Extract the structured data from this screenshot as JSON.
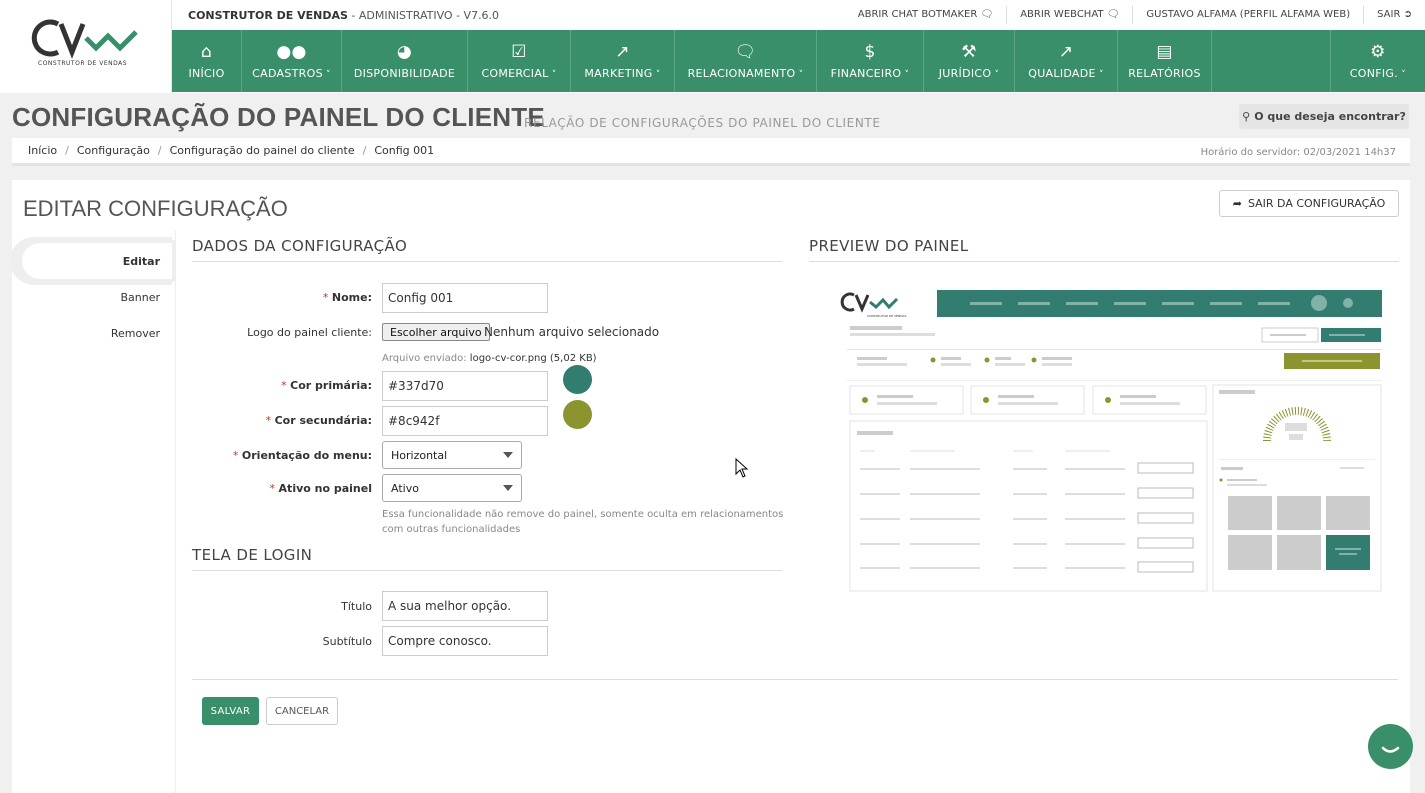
{
  "header": {
    "logo_sub": "CONSTRUTOR DE VENDAS",
    "system_name": "CONSTRUTOR DE VENDAS",
    "system_suffix": " - ADMINISTRATIVO - V7.6.0",
    "links": {
      "chat_botmaker": "ABRIR CHAT BOTMAKER",
      "webchat": "ABRIR WEBCHAT",
      "user": "GUSTAVO ALFAMA (PERFIL ALFAMA WEB)",
      "logout": "SAIR"
    }
  },
  "nav": {
    "inicio": "INÍCIO",
    "cadastros": "CADASTROS",
    "disponibilidade": "DISPONIBILIDADE",
    "comercial": "COMERCIAL",
    "marketing": "MARKETING",
    "relacionamento": "RELACIONAMENTO",
    "financeiro": "FINANCEIRO",
    "juridico": "JURÍDICO",
    "qualidade": "QUALIDADE",
    "relatorios": "RELATÓRIOS",
    "config": "CONFIG."
  },
  "page": {
    "title": "CONFIGURAÇÃO DO PAINEL DO CLIENTE",
    "subtitle": "RELAÇÃO DE CONFIGURAÇÕES DO PAINEL DO CLIENTE",
    "search_label": "O que deseja encontrar?"
  },
  "breadcrumb": {
    "items": [
      "Início",
      "Configuração",
      "Configuração do painel do cliente",
      "Config 001"
    ],
    "server_time": "Horário do servidor: 02/03/2021 14h37"
  },
  "card": {
    "title": "EDITAR CONFIGURAÇÃO",
    "exit_label": "SAIR DA CONFIGURAÇÃO"
  },
  "sidenav": {
    "edit": "Editar",
    "banner": "Banner",
    "remove": "Remover"
  },
  "form": {
    "section_data": "DADOS DA CONFIGURAÇÃO",
    "section_login": "TELA DE LOGIN",
    "section_preview": "PREVIEW DO PAINEL",
    "name_label": "Nome:",
    "name_value": "Config 001",
    "logo_label": "Logo do painel cliente:",
    "file_button": "Escolher arquivo",
    "file_none": "Nenhum arquivo selecionado",
    "file_sent_prefix": "Arquivo enviado:",
    "file_sent_name": "logo-cv-cor.png (5,02 KB)",
    "primary_label": "Cor primária:",
    "primary_value": "#337d70",
    "secondary_label": "Cor secundária:",
    "secondary_value": "#8c942f",
    "orientation_label": "Orientação do menu:",
    "orientation_value": "Horizontal",
    "active_label": "Ativo no painel",
    "active_value": "Ativo",
    "active_hint_1": "Essa funcionalidade não remove do painel, somente oculta em relacionamentos",
    "active_hint_2": "com outras funcionalidades",
    "title_label": "Título",
    "title_value": "A sua melhor opção.",
    "subtitle_label": "Subtítulo",
    "subtitle_value": "Compre conosco.",
    "save": "SALVAR",
    "cancel": "CANCELAR"
  },
  "preview": {
    "logo_sub": "CONSTRUTOR DE VENDAS"
  },
  "colors": {
    "brand": "#3a8f6b",
    "primary": "#337d70",
    "secondary": "#8c942f"
  }
}
